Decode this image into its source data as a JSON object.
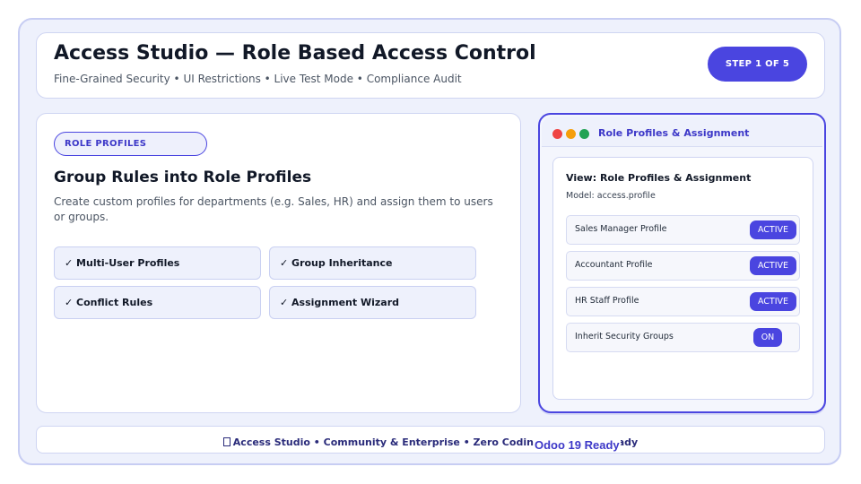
{
  "header": {
    "title": "Access Studio — Role Based Access Control",
    "subtitle": "Fine-Grained Security • UI Restrictions • Live Test Mode • Compliance Audit",
    "step_badge": "STEP 1 OF 5"
  },
  "main": {
    "tag": "ROLE PROFILES",
    "title": "Group Rules into Role Profiles",
    "description": "Create custom profiles for departments (e.g. Sales, HR) and assign them to users or groups.",
    "features": [
      "✓ Multi-User Profiles",
      "✓ Group Inheritance",
      "✓ Conflict Rules",
      "✓ Assignment Wizard"
    ]
  },
  "panel": {
    "window_title": "Role Profiles & Assignment",
    "view_title": "View: Role Profiles & Assignment",
    "model": "Model: access.profile",
    "rows": [
      {
        "label": "Sales Manager Profile",
        "status": "ACTIVE"
      },
      {
        "label": "Accountant Profile",
        "status": "ACTIVE"
      },
      {
        "label": "HR Staff Profile",
        "status": "ACTIVE"
      },
      {
        "label": "Inherit Security Groups",
        "status": "ON"
      }
    ]
  },
  "footer": {
    "icon": "box-icon",
    "text": "Access Studio • Community & Enterprise • Zero Coding • Odoo 19 Ready",
    "overlay": "Odoo 19 Ready"
  },
  "colors": {
    "accent": "#4a45e0",
    "frame_bg": "#eef1fc",
    "dot_red": "#ef4444",
    "dot_amber": "#f59e0b",
    "dot_green": "#22a355"
  }
}
